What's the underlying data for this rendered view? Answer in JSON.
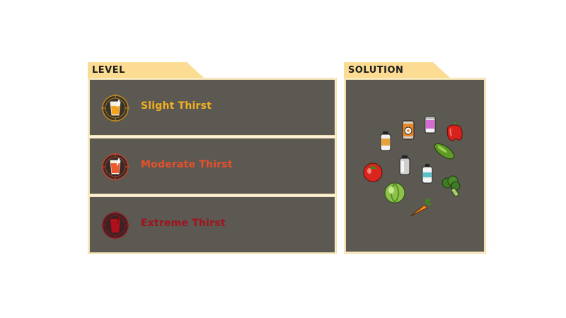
{
  "level": {
    "header": "LEVEL",
    "options": [
      {
        "label": "Slight Thirst",
        "color": "#f1b021",
        "icon": "slight-thirst-glass-icon"
      },
      {
        "label": "Moderate Thirst",
        "color": "#e8502a",
        "icon": "moderate-thirst-glass-icon"
      },
      {
        "label": "Extreme Thirst",
        "color": "#a3121d",
        "icon": "extreme-thirst-glass-icon"
      }
    ]
  },
  "solution": {
    "header": "SOLUTION",
    "items": [
      "supplement-bottle-icon",
      "soda-can-icon",
      "pink-jar-icon",
      "red-pepper-icon",
      "cucumber-icon",
      "tomato-icon",
      "grey-bottle-icon",
      "water-bottle-icon",
      "broccoli-icon",
      "cabbage-icon",
      "carrot-icon"
    ]
  },
  "colors": {
    "tab_background": "#fbdc92",
    "card_background": "#5c5852",
    "frame_border": "#f3dea4"
  }
}
